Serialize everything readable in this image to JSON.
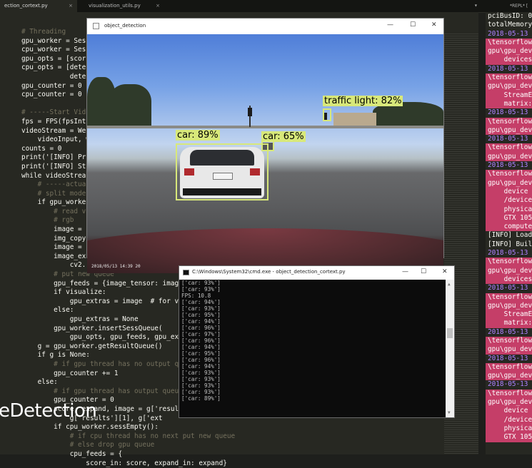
{
  "editor_tabs": {
    "tab1": "ection_cortext.py",
    "tab2": "visualization_utils.py",
    "right_tab": "*REPL* [",
    "close": "×"
  },
  "code_lines": [
    {
      "t": "# Threading",
      "cls": "c"
    },
    {
      "t": "gpu_worker = Sess",
      "cls": ""
    },
    {
      "t": "cpu_worker = Sess",
      "cls": ""
    },
    {
      "t": "gpu_opts = [scor",
      "cls": ""
    },
    {
      "t": "cpu_opts = [dete",
      "cls": ""
    },
    {
      "t": "            dete",
      "cls": ""
    },
    {
      "t": "gpu_counter = 0",
      "cls": ""
    },
    {
      "t": "cpu_counter = 0",
      "cls": ""
    },
    {
      "t": "",
      "cls": ""
    },
    {
      "t": "# -----Start Vid",
      "cls": "c"
    },
    {
      "t": "fps = FPS(fpsInt",
      "cls": ""
    },
    {
      "t": "videoStream = We",
      "cls": ""
    },
    {
      "t": "    videoInput, w",
      "cls": ""
    },
    {
      "t": "counts = 0",
      "cls": ""
    },
    {
      "t": "print('[INFO] Pr",
      "cls": ""
    },
    {
      "t": "print('[INFO] St",
      "cls": ""
    },
    {
      "t": "while videoStrea",
      "cls": ""
    },
    {
      "t": "    # -----actua",
      "cls": "c"
    },
    {
      "t": "    # split mode",
      "cls": "c"
    },
    {
      "t": "    if gpu_worker",
      "cls": ""
    },
    {
      "t": "        # read v",
      "cls": "c"
    },
    {
      "t": "        # rgb",
      "cls": "c"
    },
    {
      "t": "        image = ",
      "cls": ""
    },
    {
      "t": "        img_copy",
      "cls": ""
    },
    {
      "t": "        image = ",
      "cls": ""
    },
    {
      "t": "        image_ex",
      "cls": ""
    },
    {
      "t": "            cv2.",
      "cls": ""
    },
    {
      "t": "        # put new queue",
      "cls": "c"
    },
    {
      "t": "        gpu_feeds = {image_tensor: imag",
      "cls": ""
    },
    {
      "t": "        if visualize:",
      "cls": ""
    },
    {
      "t": "            gpu_extras = image  # for v",
      "cls": ""
    },
    {
      "t": "        else:",
      "cls": ""
    },
    {
      "t": "            gpu_extras = None",
      "cls": ""
    },
    {
      "t": "        gpu_worker.insertSessQueue(",
      "cls": ""
    },
    {
      "t": "            gpu_opts, gpu_feeds, gpu_ex",
      "cls": ""
    },
    {
      "t": "    g = gpu_worker.getResultQueue()",
      "cls": ""
    },
    {
      "t": "    if g is None:",
      "cls": ""
    },
    {
      "t": "        # if gpu thread has no output q",
      "cls": "c"
    },
    {
      "t": "        gpu_counter += 1",
      "cls": ""
    },
    {
      "t": "    else:",
      "cls": ""
    },
    {
      "t": "        # if gpu thread has output queu",
      "cls": "c"
    },
    {
      "t": "        gpu_counter = 0",
      "cls": ""
    },
    {
      "t": "        score, expand, image = g['result",
      "cls": ""
    },
    {
      "t": "            g['results'][1], g['ext",
      "cls": ""
    },
    {
      "t": "        if cpu_worker.sessEmpty():",
      "cls": ""
    },
    {
      "t": "            # if cpu thread has no next put new queue",
      "cls": "c"
    },
    {
      "t": "            # else drop gpu queue",
      "cls": "c"
    },
    {
      "t": "            cpu_feeds = {",
      "cls": ""
    },
    {
      "t": "                score_in: score, expand_in: expand}",
      "cls": ""
    }
  ],
  "right_panel": [
    {
      "t": "pciBusID: 0",
      "c": "w"
    },
    {
      "t": "totalMemory",
      "c": "w"
    },
    {
      "t": "2018-05-13",
      "c": "p"
    },
    {
      "t": "\\tensorflow",
      "c": "e"
    },
    {
      "t": "gpu\\gpu_dev",
      "c": "e"
    },
    {
      "t": "    devices",
      "c": "e"
    },
    {
      "t": "2018-05-13",
      "c": "p"
    },
    {
      "t": "\\tensorflow",
      "c": "e"
    },
    {
      "t": "gpu\\gpu_dev",
      "c": "e"
    },
    {
      "t": "    StreamE",
      "c": "e"
    },
    {
      "t": "    matrix:",
      "c": "e"
    },
    {
      "t": "2018-05-13",
      "c": "p"
    },
    {
      "t": "\\tensorflow",
      "c": "e"
    },
    {
      "t": "gpu\\gpu_dev",
      "c": "e"
    },
    {
      "t": "2018-05-13",
      "c": "p"
    },
    {
      "t": "\\tensorflow",
      "c": "e"
    },
    {
      "t": "gpu\\gpu_dev",
      "c": "e"
    },
    {
      "t": "2018-05-13",
      "c": "p"
    },
    {
      "t": "\\tensorflow",
      "c": "e"
    },
    {
      "t": "gpu\\gpu_dev",
      "c": "e"
    },
    {
      "t": "    device",
      "c": "e"
    },
    {
      "t": "    /device",
      "c": "e"
    },
    {
      "t": "    physica",
      "c": "e"
    },
    {
      "t": "    GTX 105",
      "c": "e"
    },
    {
      "t": "    compute",
      "c": "e"
    },
    {
      "t": "[INFO] Load",
      "c": "w"
    },
    {
      "t": "[INFO] Buil",
      "c": "w"
    },
    {
      "t": "2018-05-13",
      "c": "p"
    },
    {
      "t": "\\tensorflow",
      "c": "e"
    },
    {
      "t": "gpu\\gpu_dev",
      "c": "e"
    },
    {
      "t": "    devices",
      "c": "e"
    },
    {
      "t": "2018-05-13",
      "c": "p"
    },
    {
      "t": "\\tensorflow",
      "c": "e"
    },
    {
      "t": "gpu\\gpu_dev",
      "c": "e"
    },
    {
      "t": "    StreamE",
      "c": "e"
    },
    {
      "t": "    matrix:",
      "c": "e"
    },
    {
      "t": "2018-05-13",
      "c": "p"
    },
    {
      "t": "\\tensorflow",
      "c": "e"
    },
    {
      "t": "gpu\\gpu_dev",
      "c": "e"
    },
    {
      "t": "2018-05-13",
      "c": "p"
    },
    {
      "t": "\\tensorflow",
      "c": "e"
    },
    {
      "t": "gpu\\gpu_dev",
      "c": "e"
    },
    {
      "t": "2018-05-13",
      "c": "p"
    },
    {
      "t": "\\tensorflow",
      "c": "e"
    },
    {
      "t": "gpu\\gpu_dev",
      "c": "e"
    },
    {
      "t": "    device",
      "c": "e"
    },
    {
      "t": "    /device",
      "c": "e"
    },
    {
      "t": "    physica",
      "c": "e"
    },
    {
      "t": "    GTX 105",
      "c": "e"
    }
  ],
  "detection_window": {
    "title": "object_detection",
    "detections": {
      "car1": "car: 89%",
      "car2": "car: 65%",
      "traffic_light": "traffic light: 82%"
    },
    "timestamp": "2018/05/13  14:39 20"
  },
  "cmd_window": {
    "title": "C:\\Windows\\System32\\cmd.exe - object_detection_cortext.py",
    "lines": [
      "['car: 93%']",
      "['car: 93%']",
      "FPS: 10.8",
      "['car: 94%']",
      "['car: 93%']",
      "['car: 95%']",
      "['car: 94%']",
      "['car: 96%']",
      "['car: 97%']",
      "['car: 96%']",
      "['car: 94%']",
      "['car: 95%']",
      "['car: 96%']",
      "['car: 94%']",
      "['car: 93%']",
      "['car: 93%']",
      "['car: 93%']",
      "['car: 93%']",
      "['car: 89%']"
    ]
  },
  "overlay_text": "eDetection",
  "window_controls": {
    "minimize": "—",
    "maximize": "☐",
    "close": "✕"
  }
}
